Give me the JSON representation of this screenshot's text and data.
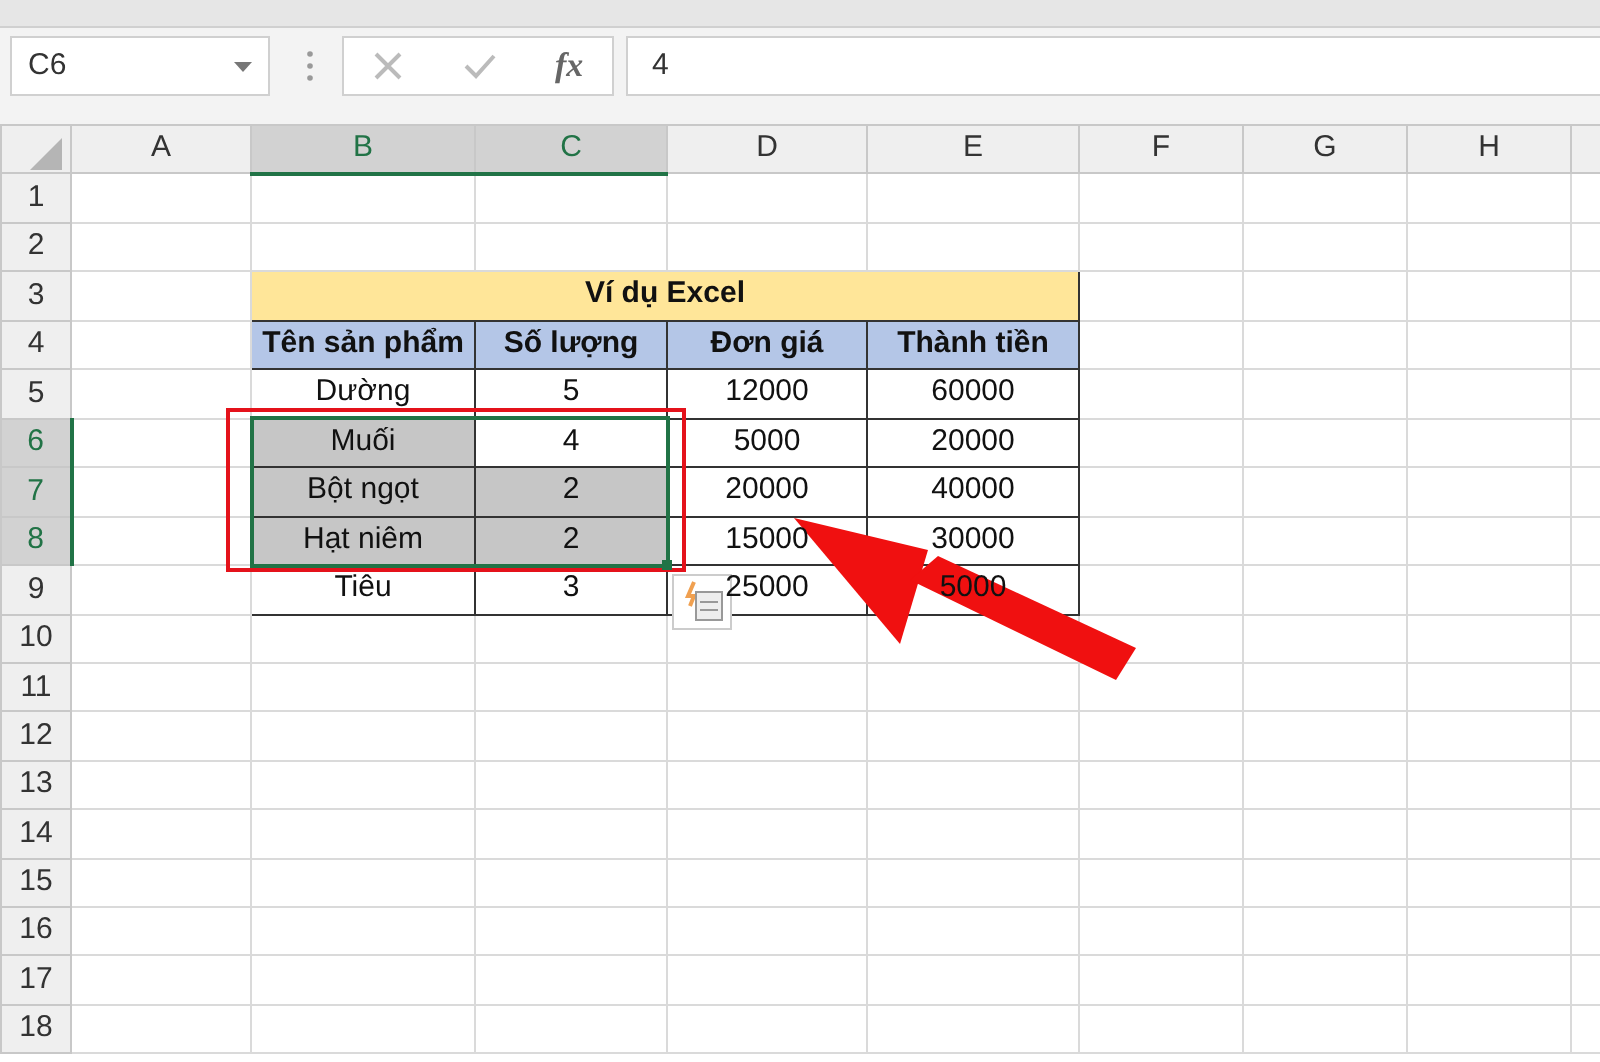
{
  "name_box": {
    "value": "C6"
  },
  "formula_bar": {
    "function_label": "fx",
    "value": "4"
  },
  "columns": [
    {
      "label": "A",
      "selected": false
    },
    {
      "label": "B",
      "selected": true
    },
    {
      "label": "C",
      "selected": true
    },
    {
      "label": "D",
      "selected": false
    },
    {
      "label": "E",
      "selected": false
    },
    {
      "label": "F",
      "selected": false
    },
    {
      "label": "G",
      "selected": false
    },
    {
      "label": "H",
      "selected": false
    }
  ],
  "rows": [
    {
      "label": "1",
      "selected": false
    },
    {
      "label": "2",
      "selected": false
    },
    {
      "label": "3",
      "selected": false
    },
    {
      "label": "4",
      "selected": false
    },
    {
      "label": "5",
      "selected": false
    },
    {
      "label": "6",
      "selected": true
    },
    {
      "label": "7",
      "selected": true
    },
    {
      "label": "8",
      "selected": true
    },
    {
      "label": "9",
      "selected": false
    },
    {
      "label": "10",
      "selected": false
    },
    {
      "label": "11",
      "selected": false
    },
    {
      "label": "12",
      "selected": false
    },
    {
      "label": "13",
      "selected": false
    },
    {
      "label": "14",
      "selected": false
    },
    {
      "label": "15",
      "selected": false
    },
    {
      "label": "16",
      "selected": false
    },
    {
      "label": "17",
      "selected": false
    },
    {
      "label": "18",
      "selected": false
    }
  ],
  "table": {
    "title": "Ví dụ Excel",
    "headers": [
      "Tên sản phẩm",
      "Số lượng",
      "Đơn giá",
      "Thành tiền"
    ],
    "rows": [
      {
        "cells": [
          {
            "text": "Dường",
            "selected": false,
            "active": false
          },
          {
            "text": "5",
            "selected": false,
            "active": false
          },
          {
            "text": "12000",
            "selected": false,
            "active": false
          },
          {
            "text": "60000",
            "selected": false,
            "active": false
          }
        ]
      },
      {
        "cells": [
          {
            "text": "Muối",
            "selected": true,
            "active": false
          },
          {
            "text": "4",
            "selected": true,
            "active": true
          },
          {
            "text": "5000",
            "selected": false,
            "active": false
          },
          {
            "text": "20000",
            "selected": false,
            "active": false
          }
        ]
      },
      {
        "cells": [
          {
            "text": "Bột ngọt",
            "selected": true,
            "active": false
          },
          {
            "text": "2",
            "selected": true,
            "active": false
          },
          {
            "text": "20000",
            "selected": false,
            "active": false
          },
          {
            "text": "40000",
            "selected": false,
            "active": false
          }
        ]
      },
      {
        "cells": [
          {
            "text": "Hạt niêm",
            "selected": true,
            "active": false
          },
          {
            "text": "2",
            "selected": true,
            "active": false
          },
          {
            "text": "15000",
            "selected": false,
            "active": false
          },
          {
            "text": "30000",
            "selected": false,
            "active": false
          }
        ]
      },
      {
        "cells": [
          {
            "text": "Tiêu",
            "selected": false,
            "active": false
          },
          {
            "text": "3",
            "selected": false,
            "active": false
          },
          {
            "text": "25000",
            "selected": false,
            "active": false
          },
          {
            "text": "5000",
            "selected": false,
            "active": false
          }
        ]
      }
    ]
  },
  "annotations": {
    "highlight_box": {
      "color": "#e4121b"
    },
    "arrow": {
      "color": "#f01010"
    }
  }
}
